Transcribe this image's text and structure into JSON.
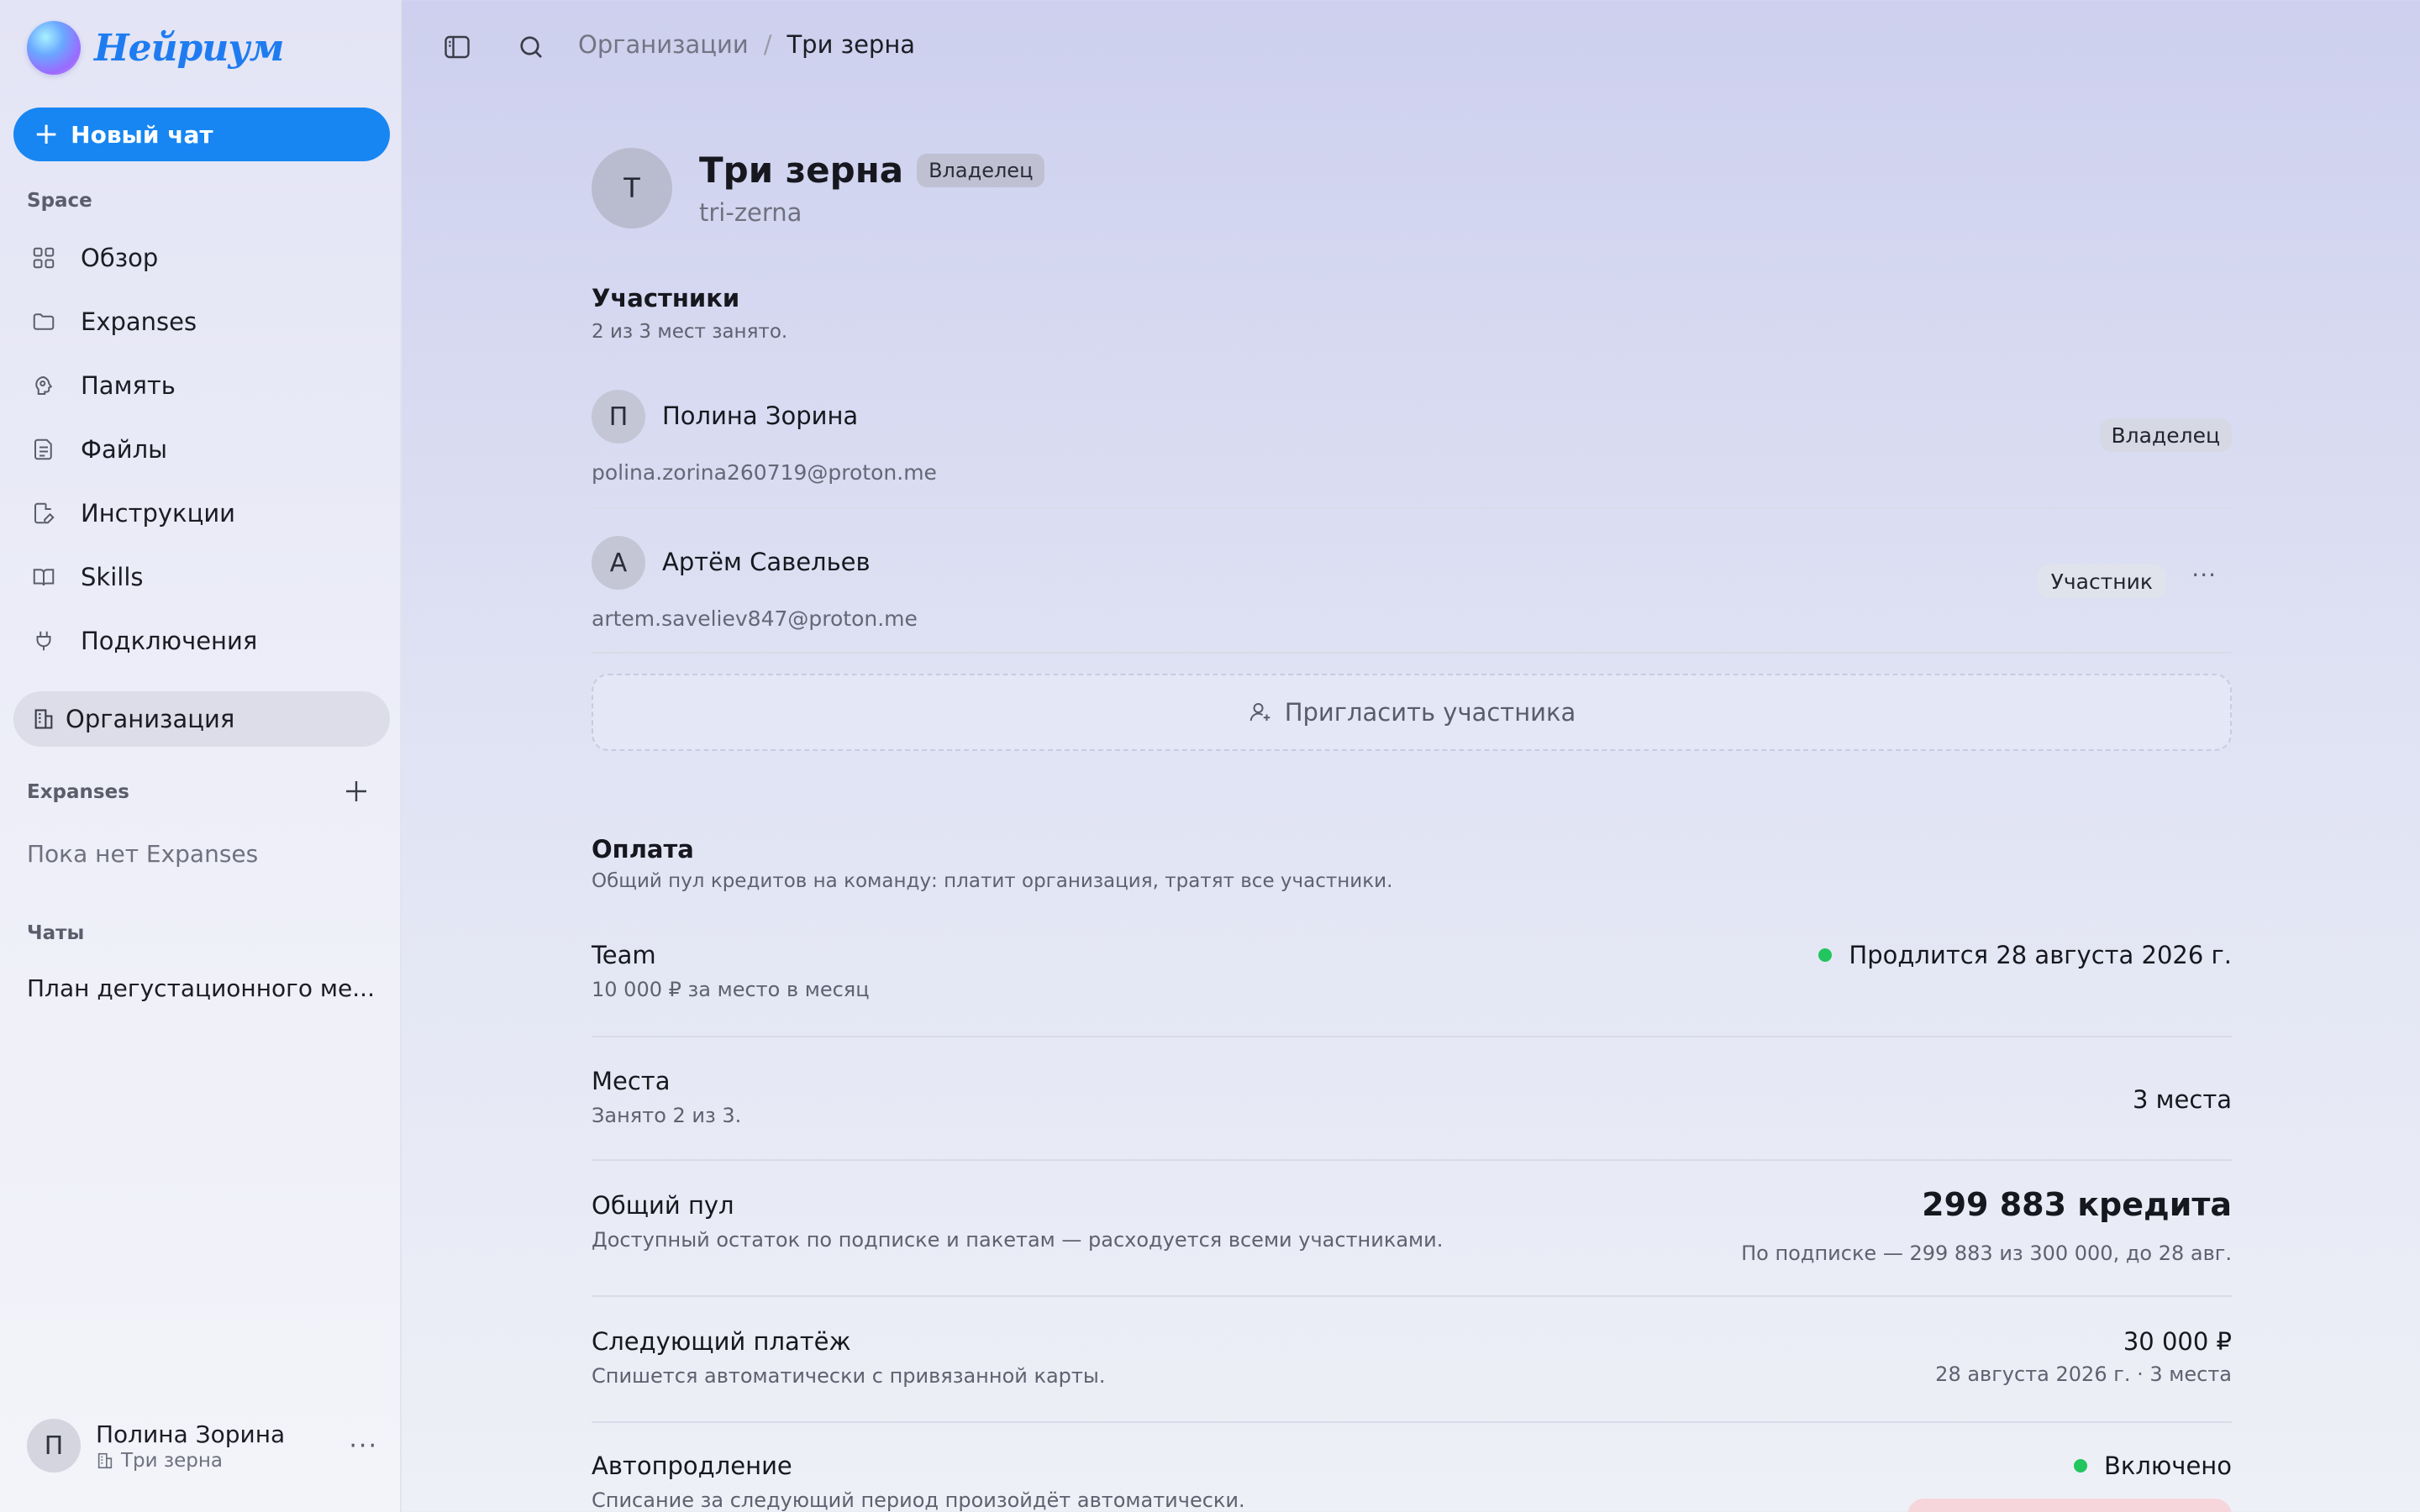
{
  "app": {
    "logo_text": "Нейриум",
    "brand_color": "#1786f2"
  },
  "sidebar": {
    "new_chat_label": "Новый чат",
    "space_label": "Space",
    "items": [
      {
        "label": "Обзор",
        "icon": "grid-icon"
      },
      {
        "label": "Expanses",
        "icon": "folder-icon"
      },
      {
        "label": "Память",
        "icon": "brain-icon"
      },
      {
        "label": "Файлы",
        "icon": "file-icon"
      },
      {
        "label": "Инструкции",
        "icon": "edit-document-icon"
      },
      {
        "label": "Skills",
        "icon": "book-icon"
      },
      {
        "label": "Подключения",
        "icon": "plug-icon"
      }
    ],
    "active_item": {
      "label": "Организация",
      "icon": "building-icon"
    },
    "expanses_label": "Expanses",
    "expanses_empty": "Пока нет Expanses",
    "chats_label": "Чаты",
    "chats": [
      "План дегустационного ме..."
    ],
    "user": {
      "initial": "П",
      "name": "Полина Зорина",
      "org": "Три зерна"
    }
  },
  "breadcrumb": {
    "parent": "Организации",
    "separator": "/",
    "current": "Три зерна"
  },
  "org": {
    "initial": "Т",
    "name": "Три зерна",
    "role_badge": "Владелец",
    "slug": "tri-zerna"
  },
  "members_section": {
    "title": "Участники",
    "subtitle": "2 из 3 мест занято.",
    "members": [
      {
        "initial": "П",
        "name": "Полина Зорина",
        "email": "polina.zorina260719@proton.me",
        "role": "Владелец"
      },
      {
        "initial": "А",
        "name": "Артём Савельев",
        "email": "artem.saveliev847@proton.me",
        "role": "Участник"
      }
    ],
    "invite_label": "Пригласить участника"
  },
  "billing": {
    "title": "Оплата",
    "subtitle": "Общий пул кредитов на команду: платит организация, тратят все участники.",
    "plan": {
      "name": "Team",
      "price": "10 000 ₽ за место в месяц",
      "status": "Продлится 28 августа 2026 г.",
      "status_color": "#22c55e"
    },
    "seats": {
      "title": "Места",
      "sub": "Занято 2 из 3.",
      "value": "3 места"
    },
    "pool": {
      "title": "Общий пул",
      "sub": "Доступный остаток по подписке и пакетам — расходуется всеми участниками.",
      "value": "299 883 кредита",
      "note": "По подписке — 299 883 из 300 000, до 28 авг."
    },
    "next_payment": {
      "title": "Следующий платёж",
      "sub": "Спишется автоматически с привязанной карты.",
      "value": "30 000 ₽",
      "note": "28 августа 2026 г. · 3 места"
    },
    "autorenew": {
      "title": "Автопродление",
      "sub": "Списание за следующий период произойдёт автоматически.",
      "value": "Включено"
    }
  }
}
